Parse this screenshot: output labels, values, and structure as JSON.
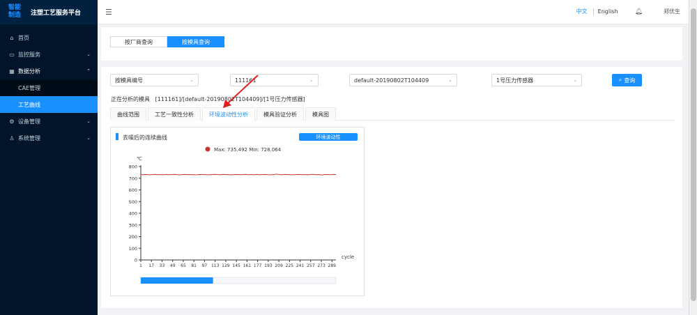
{
  "sidebar": {
    "logo_mark_line1": "智能",
    "logo_mark_line2": "制造",
    "logo_title": "注塑工艺服务平台",
    "items": [
      {
        "label": "首页",
        "icon": "home-icon",
        "glyph": "⌂"
      },
      {
        "label": "监控服务",
        "icon": "monitor-icon",
        "glyph": "▭"
      },
      {
        "label": "数据分析",
        "icon": "grid-icon",
        "glyph": "▦"
      },
      {
        "label": "CAE管理"
      },
      {
        "label": "工艺曲线"
      },
      {
        "label": "设备管理",
        "icon": "settings-icon",
        "glyph": "⚙"
      },
      {
        "label": "系统管理",
        "icon": "user-icon",
        "glyph": "♙"
      }
    ]
  },
  "header": {
    "collapse_icon": "menu-fold-icon",
    "lang_zh": "中文",
    "lang_en": "English",
    "bell_icon": "bell-icon",
    "user": "郑优生"
  },
  "segment": {
    "by_vendor": "按厂商查询",
    "by_mold": "按模具查询"
  },
  "filters": {
    "mold_id_label": "按模具编号",
    "mold_id_value": "111161",
    "batch_value": "default-20190802T104409",
    "sensor_value": "1号压力传感器",
    "query_label": "查询"
  },
  "analyzing": {
    "label": "正在分析的模具",
    "value": "[111161]/[default-20190802T104409]/[1号压力传感器]"
  },
  "tabs": [
    {
      "label": "曲线范围"
    },
    {
      "label": "工艺一致性分析"
    },
    {
      "label": "环境波动性分析"
    },
    {
      "label": "模具验证分析"
    },
    {
      "label": "模具图"
    }
  ],
  "chart_card": {
    "title": "去噪后的连续曲线",
    "tag": "环境波动性"
  },
  "chart_data": {
    "type": "line",
    "legend_text": "Max: 735.492 Min: 728.064",
    "series_color": "#c23531",
    "ylabel": "℃",
    "xlabel": "cycle",
    "ylim": [
      0,
      800
    ],
    "yticks": [
      0,
      100,
      200,
      300,
      400,
      500,
      600,
      700,
      800
    ],
    "xticks": [
      1,
      17,
      33,
      49,
      65,
      81,
      97,
      113,
      129,
      145,
      161,
      177,
      193,
      209,
      225,
      241,
      257,
      273,
      289
    ],
    "x_range": [
      1,
      295
    ],
    "series": [
      {
        "values": [
          731,
          730,
          732,
          729,
          731,
          733,
          730,
          731,
          729,
          732,
          730,
          731,
          733,
          730,
          729,
          731,
          732,
          730,
          731,
          729,
          730,
          732,
          731,
          730,
          729,
          731,
          733,
          731,
          730,
          732,
          731,
          730,
          729,
          731,
          732,
          730,
          731,
          733,
          730,
          731,
          729,
          732,
          730,
          731,
          732,
          730,
          729,
          731,
          735,
          731,
          730,
          732,
          731,
          729,
          730,
          731,
          732,
          730,
          731,
          729,
          731,
          733,
          730,
          731,
          728,
          732,
          731,
          730,
          732,
          731
        ]
      }
    ],
    "datazoom": {
      "start": 0,
      "end": 0.37
    }
  }
}
